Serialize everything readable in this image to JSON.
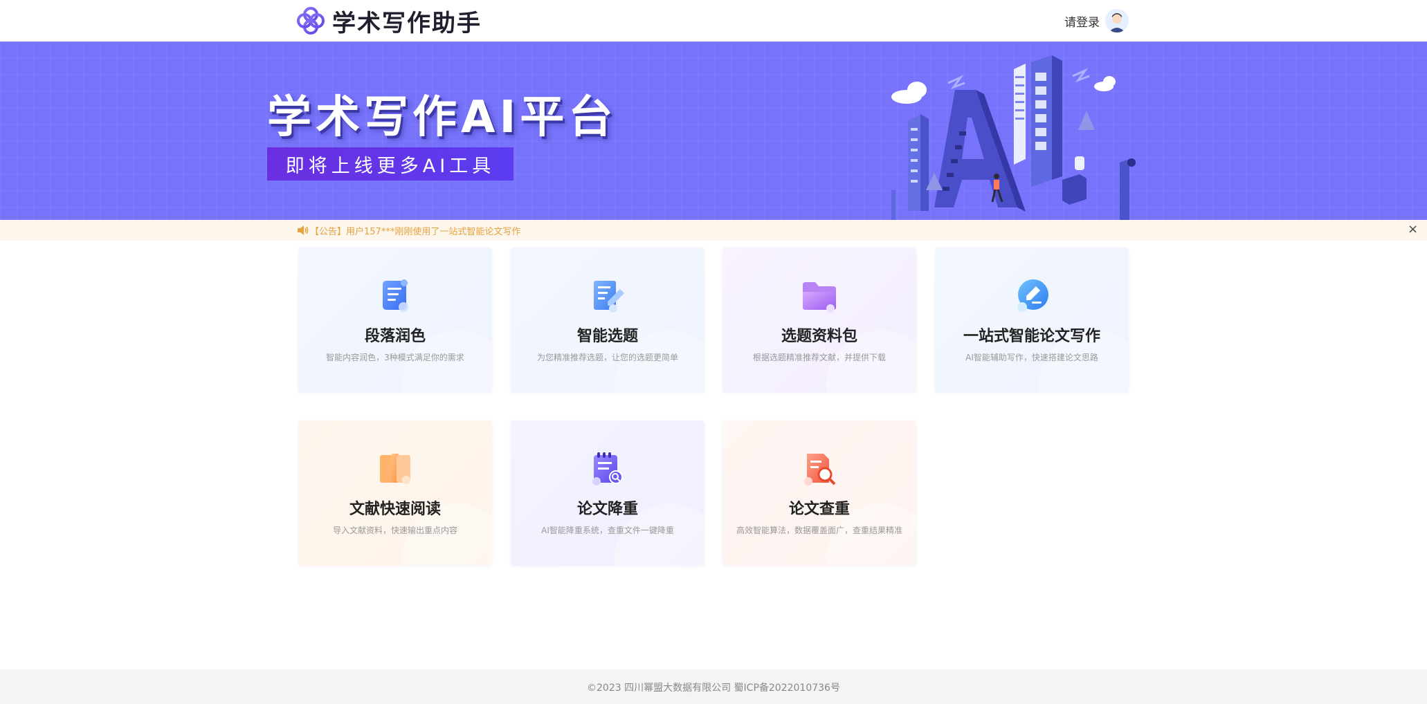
{
  "header": {
    "logo_text": "学术写作助手",
    "login_text": "请登录"
  },
  "banner": {
    "title": "学术写作AI平台",
    "subtitle": "即将上线更多AI工具"
  },
  "notice": {
    "text": "【公告】用户157***刚刚使用了一站式智能论文写作",
    "close": "×"
  },
  "cards": [
    {
      "title": "段落润色",
      "desc": "智能内容润色，3种模式满足你的需求",
      "icon": "scroll-document-icon"
    },
    {
      "title": "智能选题",
      "desc": "为您精准推荐选题，让您的选题更简单",
      "icon": "pencil-document-icon"
    },
    {
      "title": "选题资料包",
      "desc": "根据选题精准推荐文献，并提供下载",
      "icon": "folder-icon"
    },
    {
      "title": "一站式智能论文写作",
      "desc": "AI智能辅助写作，快速搭建论文思路",
      "icon": "edit-circle-icon"
    },
    {
      "title": "文献快速阅读",
      "desc": "导入文献资料，快速输出重点内容",
      "icon": "book-icon"
    },
    {
      "title": "论文降重",
      "desc": "AI智能降重系统，查重文件一键降重",
      "icon": "notepad-search-icon"
    },
    {
      "title": "论文查重",
      "desc": "高效智能算法，数据覆盖面广，查重结果精准",
      "icon": "document-magnifier-icon"
    }
  ],
  "footer": {
    "text": "©2023 四川幂盟大数据有限公司 蜀ICP备2022010736号"
  },
  "colors": {
    "banner_bg": "#7774fb",
    "accent_purple": "#6a2fe0",
    "notice_text": "#e6a23c",
    "notice_bg": "#fdf6ec"
  }
}
